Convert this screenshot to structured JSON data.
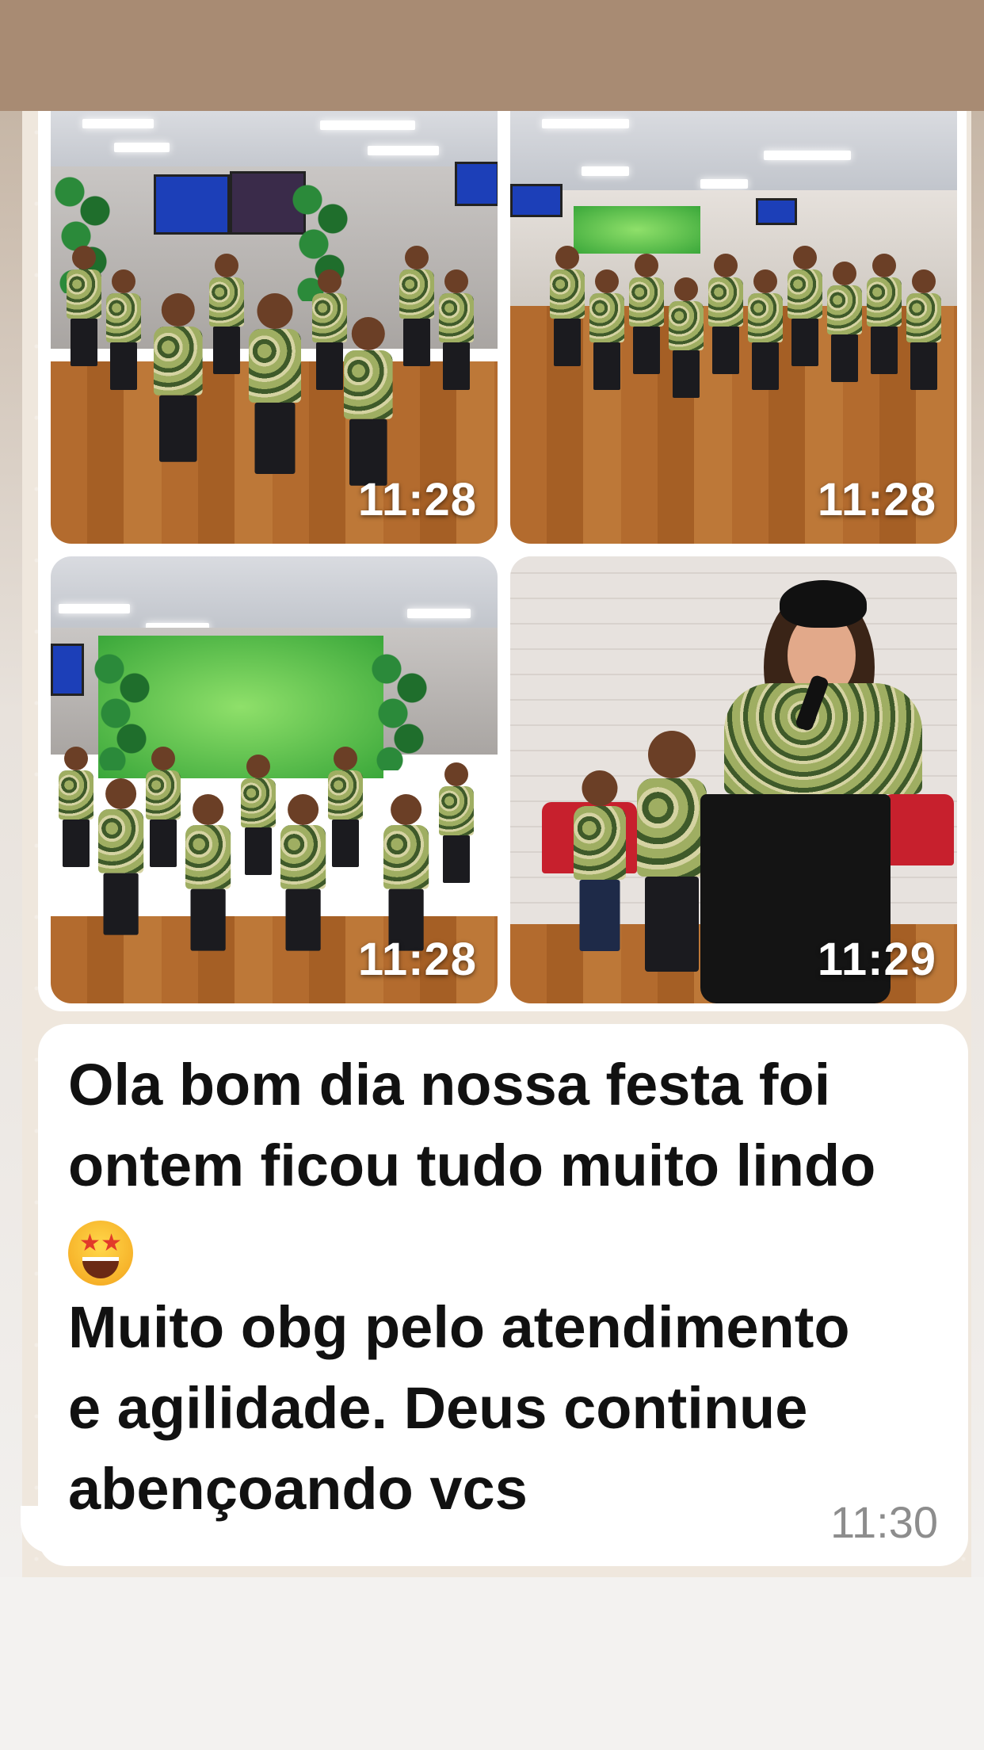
{
  "photos": [
    {
      "time": "11:28"
    },
    {
      "time": "11:28"
    },
    {
      "time": "11:28"
    },
    {
      "time": "11:29"
    }
  ],
  "message": {
    "line1": "Ola bom dia nossa festa foi",
    "line2": "ontem ficou tudo muito lindo",
    "emoji": "star-struck-emoji",
    "line3": "Muito obg pelo atendimento",
    "line4": "e agilidade. Deus continue",
    "line5": "abençoando vcs",
    "time": "11:30"
  },
  "colors": {
    "top_band": "#a88b73",
    "bubble": "#ffffff",
    "timestamp_gray": "#8d8d8d"
  }
}
